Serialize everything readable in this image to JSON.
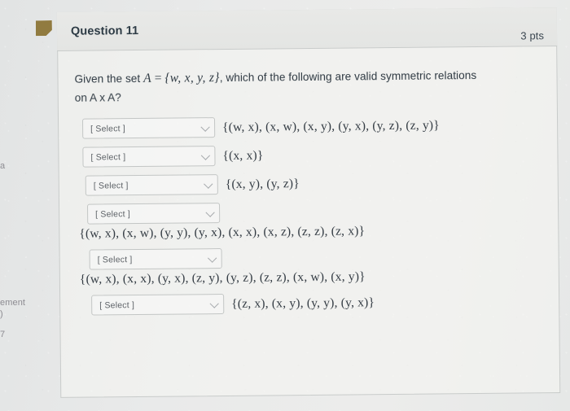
{
  "question": {
    "title": "Question 11",
    "points": "3 pts",
    "flag_icon": "flag-icon",
    "prompt_lead": "Given the set",
    "prompt_var": "A",
    "prompt_eq": "=",
    "prompt_set": "{w, x, y, z}",
    "prompt_mid": ", which of the following are valid symmetric relations",
    "prompt_tail": "on A x A?"
  },
  "select_label": "[ Select ]",
  "options": [
    {
      "select": "[ Select ]",
      "set": "{(w, x), (x, w), (x, y), (y, x), (y, z), (z, y)}",
      "layout": "inline"
    },
    {
      "select": "[ Select ]",
      "set": "{(x, x)}",
      "layout": "inline"
    },
    {
      "select": "[ Select ]",
      "set": "{(x, y), (y, z)}",
      "layout": "inline"
    },
    {
      "select": "[ Select ]",
      "set": "{(w, x), (x, w), (y, y), (y, x), (x, x), (x, z), (z, z), (z, x)}",
      "layout": "stacked"
    },
    {
      "select": "[ Select ]",
      "set": "{(w, x), (x, x), (y, x), (z, y), (y, z), (z, z), (x, w), (x, y)}",
      "layout": "stacked"
    },
    {
      "select": "[ Select ]",
      "set": "{(z, x), (x, y), (y, y), (y, x)}",
      "layout": "inline"
    }
  ],
  "edge_fragments": {
    "a": "a",
    "ement": "ement",
    "paren": ")",
    "seven": "7"
  },
  "colors": {
    "flag": "#8a7232",
    "page_bg": "#e7e8e7",
    "title_text": "#2d3b45",
    "border": "#c8cbca"
  }
}
